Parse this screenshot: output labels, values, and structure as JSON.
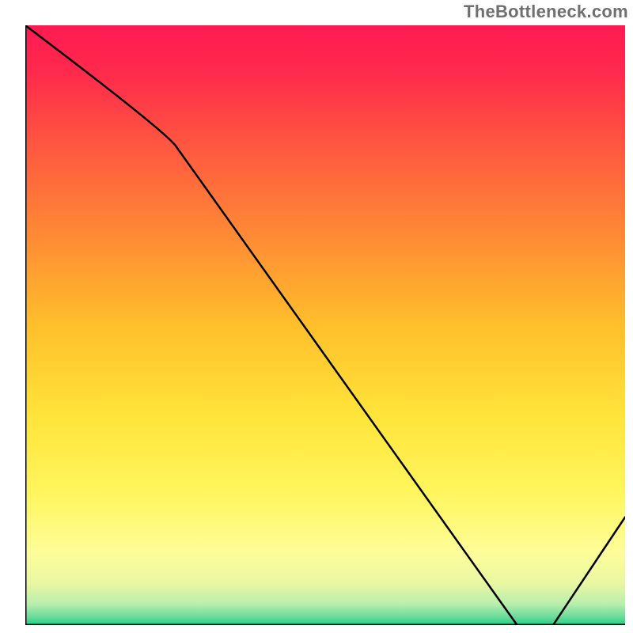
{
  "watermark": "TheBottleneck.com",
  "chart_data": {
    "type": "line",
    "title": "",
    "xlabel": "",
    "ylabel": "",
    "xlim": [
      0,
      100
    ],
    "ylim": [
      0,
      100
    ],
    "x": [
      0,
      25,
      82,
      88,
      100
    ],
    "values": [
      100,
      80,
      0,
      0,
      18
    ],
    "annotations": [
      {
        "text": "",
        "x": 83,
        "y": 1
      }
    ],
    "background_gradient": {
      "stops": [
        {
          "offset": 0.0,
          "color": "#ff1a52"
        },
        {
          "offset": 0.08,
          "color": "#ff2a4c"
        },
        {
          "offset": 0.2,
          "color": "#ff5740"
        },
        {
          "offset": 0.35,
          "color": "#ff8a35"
        },
        {
          "offset": 0.5,
          "color": "#ffbf2b"
        },
        {
          "offset": 0.65,
          "color": "#ffe43a"
        },
        {
          "offset": 0.78,
          "color": "#fff65e"
        },
        {
          "offset": 0.88,
          "color": "#fdfd9a"
        },
        {
          "offset": 0.93,
          "color": "#e9f7a2"
        },
        {
          "offset": 0.965,
          "color": "#b8eead"
        },
        {
          "offset": 0.985,
          "color": "#6fdd9c"
        },
        {
          "offset": 1.0,
          "color": "#22cf86"
        }
      ]
    }
  }
}
